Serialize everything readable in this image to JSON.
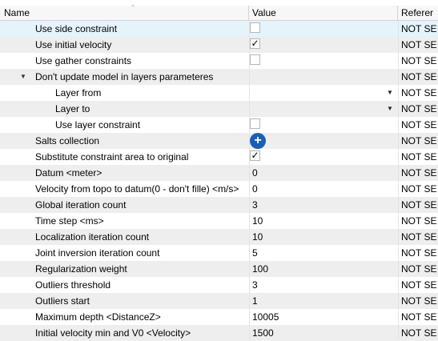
{
  "header": {
    "name": "Name",
    "value": "Value",
    "reference": "Referer"
  },
  "rows": [
    {
      "name": "Use side constraint",
      "kind": "checkbox",
      "checked": false,
      "value": "",
      "ref": "NOT SE"
    },
    {
      "name": "Use initial velocity",
      "kind": "checkbox",
      "checked": true,
      "value": "",
      "ref": "NOT SE"
    },
    {
      "name": "Use gather constraints",
      "kind": "checkbox",
      "checked": false,
      "value": "",
      "ref": "NOT SE"
    },
    {
      "name": "Don't update model in layers parameteres",
      "kind": "group",
      "value": "",
      "ref": "NOT SE"
    },
    {
      "name": "Layer from",
      "kind": "dropdown",
      "value": "",
      "ref": "NOT SE"
    },
    {
      "name": "Layer to",
      "kind": "dropdown",
      "value": "",
      "ref": "NOT SE"
    },
    {
      "name": "Use layer constraint",
      "kind": "checkbox",
      "checked": false,
      "value": "",
      "ref": "NOT SE"
    },
    {
      "name": "Salts collection",
      "kind": "add",
      "value": "",
      "ref": "NOT SE"
    },
    {
      "name": "Substitute constraint area to original",
      "kind": "checkbox",
      "checked": true,
      "value": "",
      "ref": "NOT SE"
    },
    {
      "name": "Datum <meter>",
      "kind": "text",
      "value": "0",
      "ref": "NOT SE"
    },
    {
      "name": "Velocity from topo to datum(0 - don't fille) <m/s>",
      "kind": "text",
      "value": "0",
      "ref": "NOT SE"
    },
    {
      "name": "Global iteration count",
      "kind": "text",
      "value": "3",
      "ref": "NOT SE"
    },
    {
      "name": "Time step <ms>",
      "kind": "text",
      "value": "10",
      "ref": "NOT SE"
    },
    {
      "name": "Localization iteration count",
      "kind": "text",
      "value": "10",
      "ref": "NOT SE"
    },
    {
      "name": "Joint inversion iteration count",
      "kind": "text",
      "value": "5",
      "ref": "NOT SE"
    },
    {
      "name": "Regularization weight",
      "kind": "text",
      "value": "100",
      "ref": "NOT SE"
    },
    {
      "name": "Outliers threshold",
      "kind": "text",
      "value": "3",
      "ref": "NOT SE"
    },
    {
      "name": "Outliers start",
      "kind": "text",
      "value": "1",
      "ref": "NOT SE"
    },
    {
      "name": "Maximum depth <DistanceZ>",
      "kind": "text",
      "value": "10005",
      "ref": "NOT SE"
    },
    {
      "name": "Initial velocity min and V0 <Velocity>",
      "kind": "text",
      "value": "1500",
      "ref": "NOT SE"
    }
  ],
  "icons": {
    "check": "✓",
    "add": "+",
    "expander": "▼",
    "dropdown": "▼",
    "sort": "^"
  },
  "colors": {
    "add_button": "#1a5fb4",
    "selected_row": "#e5f3fb",
    "alt_row": "#eeeeee"
  }
}
